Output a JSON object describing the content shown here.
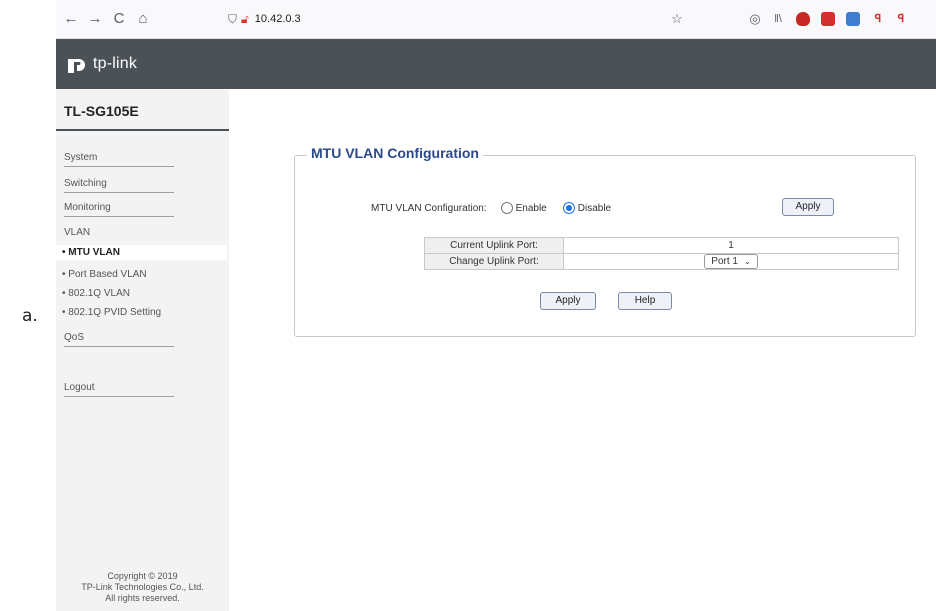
{
  "doc": {
    "marker": "a."
  },
  "browser": {
    "url": "10.42.0.3",
    "nav": {
      "back": "←",
      "forward": "→",
      "reload": "C",
      "home": "⌂"
    }
  },
  "header": {
    "brand": "tp-link"
  },
  "sidebar": {
    "model": "TL-SG105E",
    "items": [
      {
        "label": "System"
      },
      {
        "label": "Switching"
      },
      {
        "label": "Monitoring"
      },
      {
        "label": "VLAN"
      }
    ],
    "vlan_sub": [
      {
        "label": "• MTU VLAN",
        "active": true
      },
      {
        "label": "• Port Based VLAN"
      },
      {
        "label": "• 802.1Q VLAN"
      },
      {
        "label": "• 802.1Q PVID Setting"
      }
    ],
    "qos": "QoS",
    "logout": "Logout",
    "copyright": [
      "Copyright © 2019",
      "TP-Link Technologies Co., Ltd.",
      "All rights reserved."
    ]
  },
  "main": {
    "section_title": "MTU VLAN Configuration",
    "config_label": "MTU VLAN Configuration:",
    "enable_label": "Enable",
    "disable_label": "Disable",
    "selected": "Disable",
    "apply_top": "Apply",
    "table": {
      "current_label": "Current Uplink Port:",
      "current_value": "1",
      "change_label": "Change Uplink Port:",
      "change_value": "Port 1"
    },
    "apply_bottom": "Apply",
    "help": "Help"
  },
  "colors": {
    "header_bg": "#4a5157",
    "title": "#2b4a8b",
    "sidebar_bg": "#f3f3f3"
  }
}
